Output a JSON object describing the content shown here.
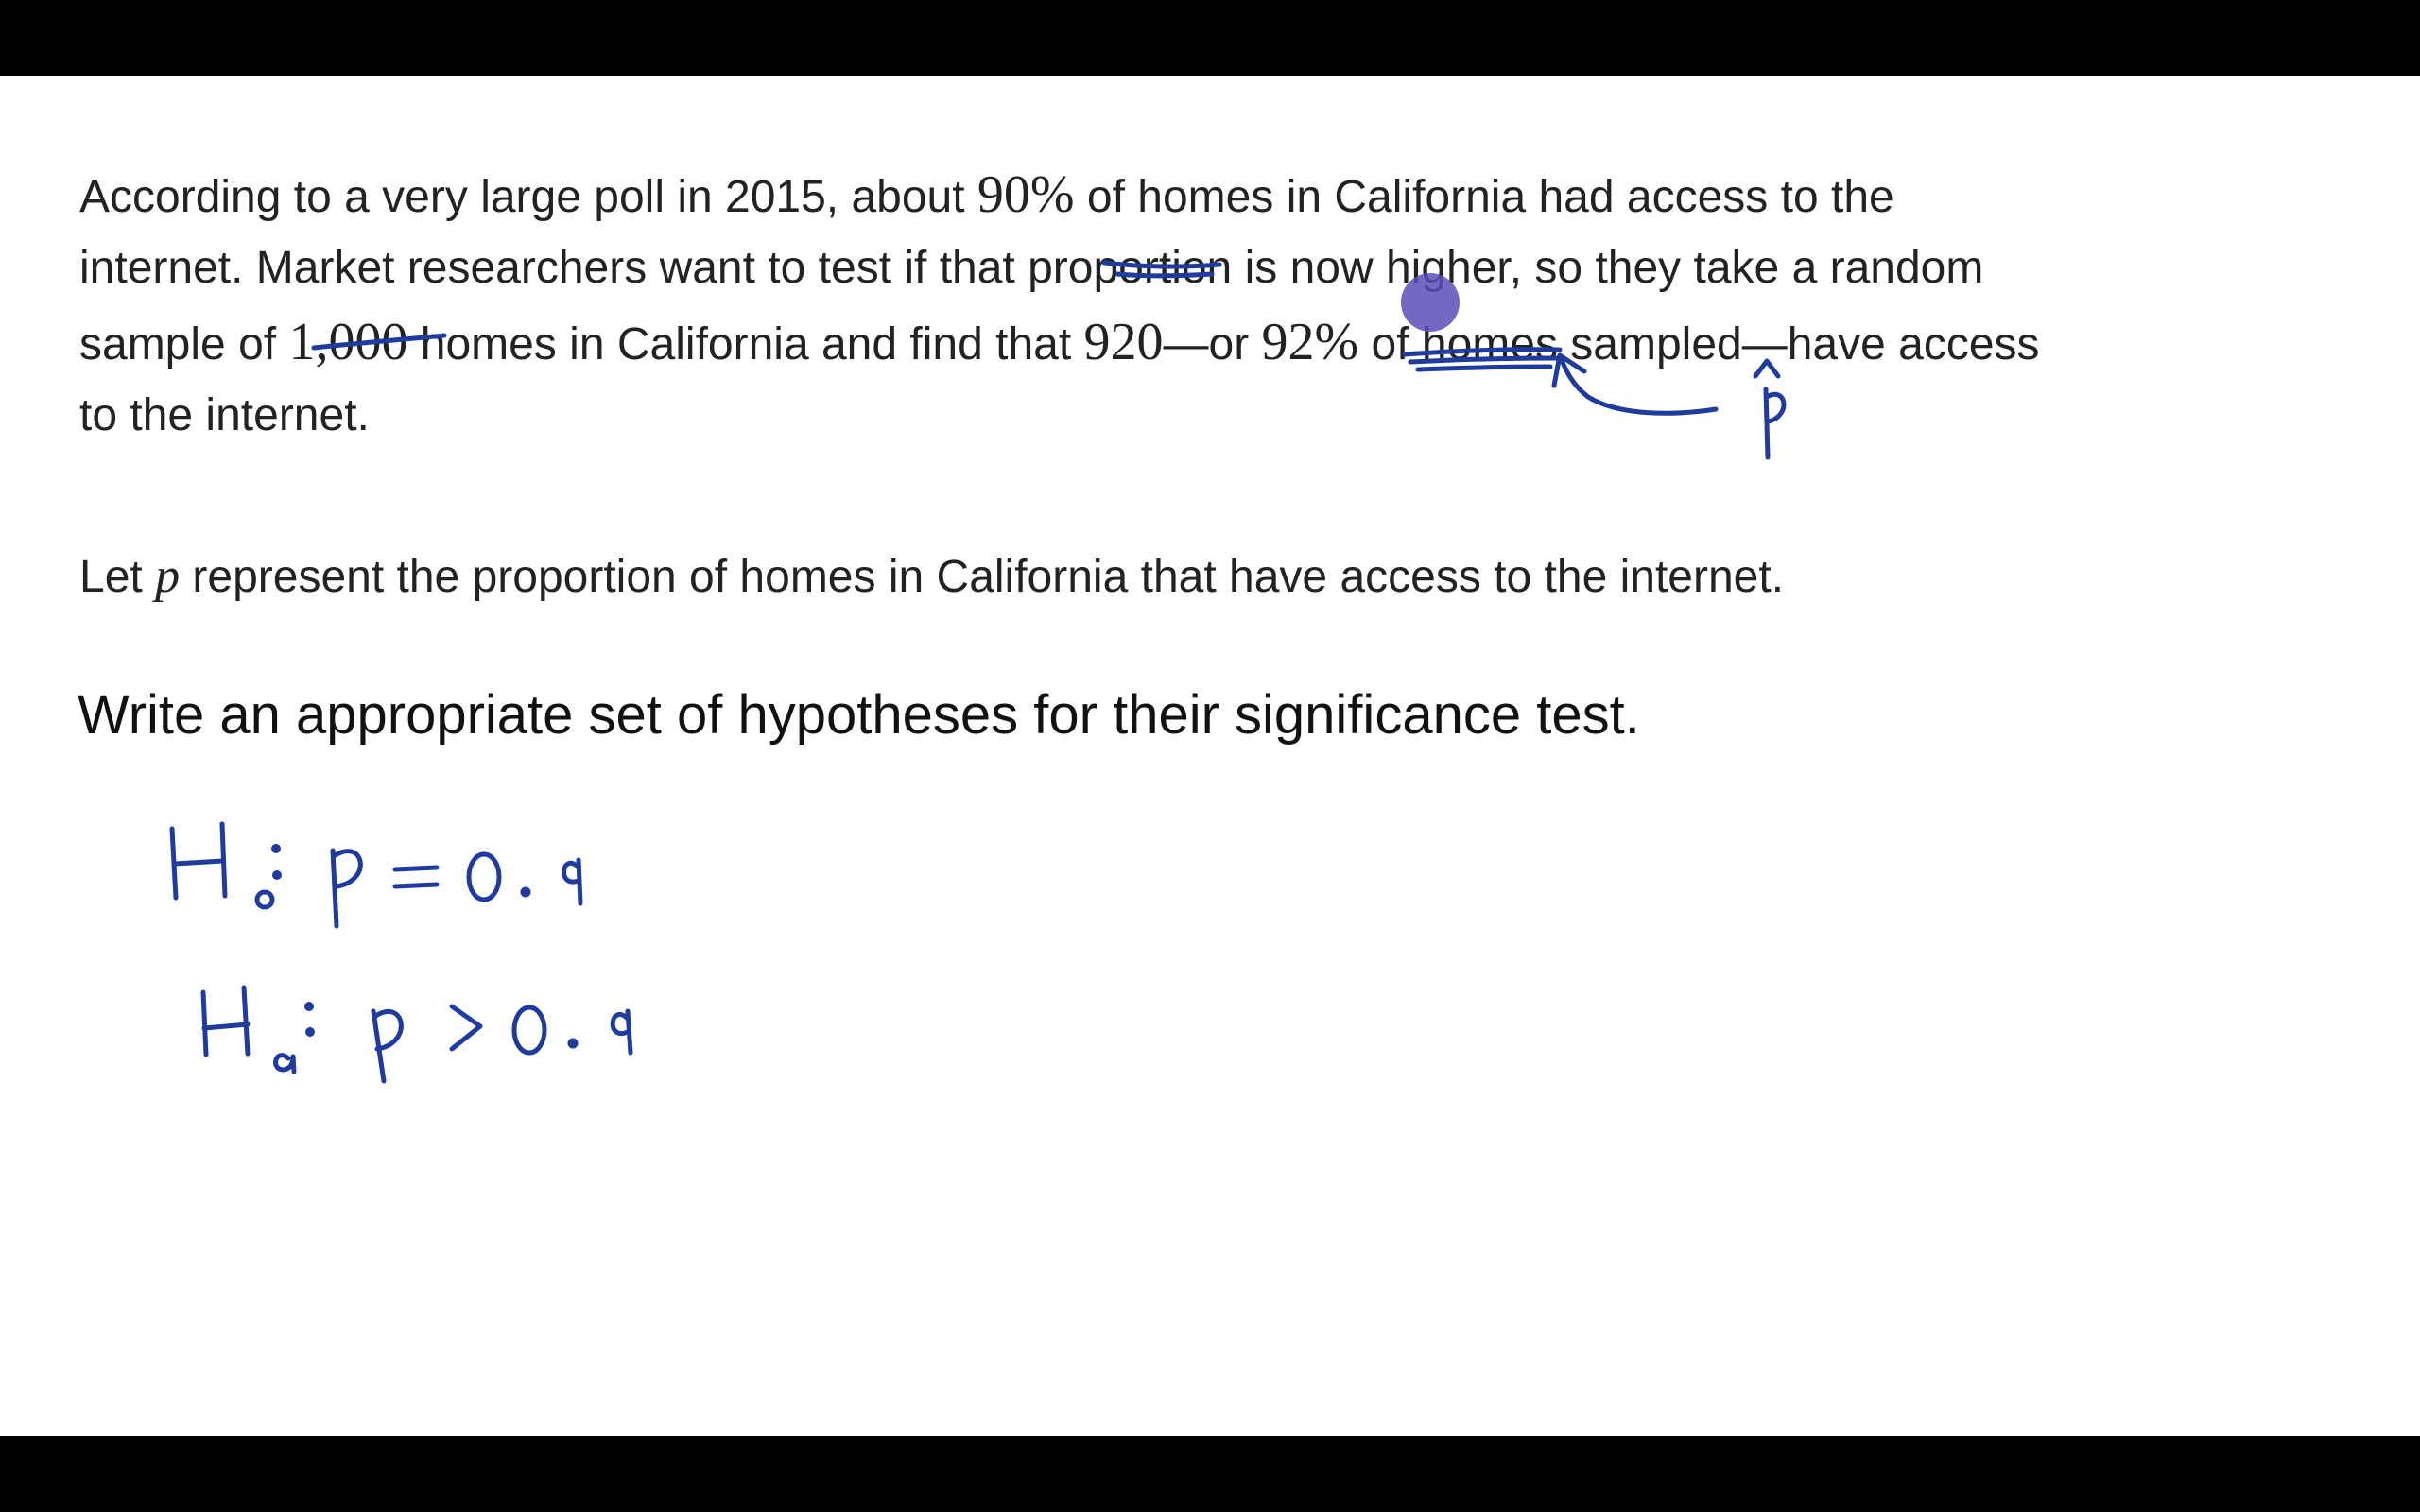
{
  "problem": {
    "line1_a": "According to a very large poll in 2015, about ",
    "pct_90": "90%",
    "line1_b": " of homes in California had access to the",
    "line2": "internet. Market researchers want to test if that proportion is now higher, so they take a random",
    "line3_a": "sample of ",
    "n_sample": "1,000",
    "line3_b": " homes in California and find that ",
    "count_920": "920",
    "dash1": "—or ",
    "pct_92": "92%",
    "line3_c": " of homes sampled—have access",
    "line4": "to the internet."
  },
  "definition": {
    "let": "Let ",
    "var": "p",
    "rest": " represent the proportion of homes in California that have access to the internet."
  },
  "question": {
    "text": "Write an appropriate set of hypotheses for their significance test."
  },
  "handwriting": {
    "ink_color": "#1f3b9e",
    "phat": "p̂",
    "h0": "H₀: p = 0.9",
    "ha": "Hₐ: p > 0.9"
  },
  "cursor_color": "#5a4fb8"
}
